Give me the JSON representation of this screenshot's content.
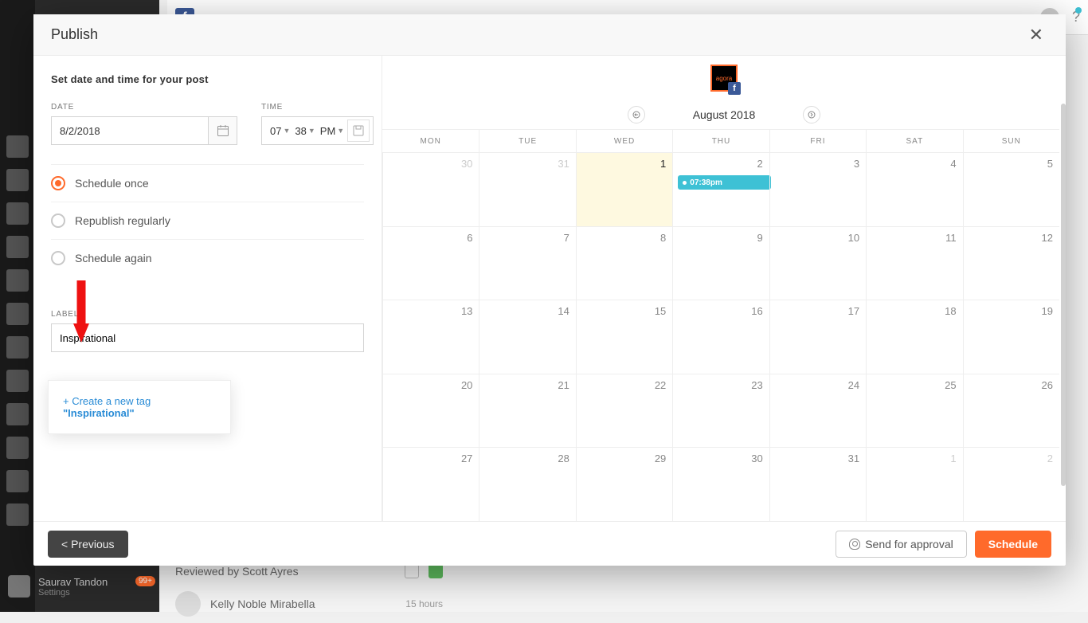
{
  "modal": {
    "title": "Publish",
    "close_aria": "Close"
  },
  "left": {
    "heading": "Set date and time for your post",
    "date_label": "DATE",
    "time_label": "TIME",
    "date_value": "8/2/2018",
    "time_hour": "07",
    "time_min": "38",
    "time_ampm": "PM",
    "options": [
      {
        "key": "once",
        "label": "Schedule once",
        "selected": true
      },
      {
        "key": "repub",
        "label": "Republish regularly",
        "selected": false
      },
      {
        "key": "again",
        "label": "Schedule again",
        "selected": false
      }
    ],
    "labels_label": "LABELS",
    "labels_value": "Inspirational",
    "popover_prefix": "+ Create a new tag",
    "popover_tag": "\"Inspirational\""
  },
  "calendar": {
    "title": "August 2018",
    "days": [
      "MON",
      "TUE",
      "WED",
      "THU",
      "FRI",
      "SAT",
      "SUN"
    ],
    "weeks": [
      [
        {
          "n": 30,
          "dim": true
        },
        {
          "n": 31,
          "dim": true
        },
        {
          "n": 1,
          "today": true
        },
        {
          "n": 2,
          "event": "07:38pm"
        },
        {
          "n": 3
        },
        {
          "n": 4
        },
        {
          "n": 5
        }
      ],
      [
        {
          "n": 6
        },
        {
          "n": 7
        },
        {
          "n": 8
        },
        {
          "n": 9
        },
        {
          "n": 10
        },
        {
          "n": 11
        },
        {
          "n": 12
        }
      ],
      [
        {
          "n": 13
        },
        {
          "n": 14
        },
        {
          "n": 15
        },
        {
          "n": 16
        },
        {
          "n": 17
        },
        {
          "n": 18
        },
        {
          "n": 19
        }
      ],
      [
        {
          "n": 20
        },
        {
          "n": 21
        },
        {
          "n": 22
        },
        {
          "n": 23
        },
        {
          "n": 24
        },
        {
          "n": 25
        },
        {
          "n": 26
        }
      ],
      [
        {
          "n": 27
        },
        {
          "n": 28
        },
        {
          "n": 29
        },
        {
          "n": 30
        },
        {
          "n": 31
        },
        {
          "n": 1,
          "dim": true
        },
        {
          "n": 2,
          "dim": true
        }
      ]
    ]
  },
  "footer": {
    "previous": "< Previous",
    "approval": "Send for approval",
    "schedule": "Schedule"
  },
  "bg": {
    "user_name": "Saurav Tandon",
    "user_sub": "Settings",
    "badge": "99+",
    "review": "Reviewed by Scott Ayres",
    "feed_name": "Kelly Noble Mirabella",
    "feed_time": "15 hours"
  }
}
